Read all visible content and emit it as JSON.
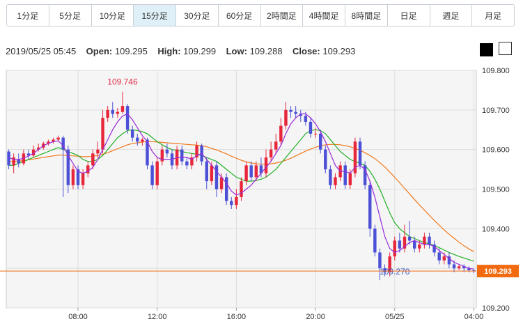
{
  "tabs": [
    {
      "label": "1分足"
    },
    {
      "label": "5分足"
    },
    {
      "label": "10分足"
    },
    {
      "label": "15分足",
      "active": true
    },
    {
      "label": "30分足"
    },
    {
      "label": "60分足"
    },
    {
      "label": "2時間足"
    },
    {
      "label": "4時間足"
    },
    {
      "label": "8時間足"
    },
    {
      "label": "日足"
    },
    {
      "label": "週足"
    },
    {
      "label": "月足"
    }
  ],
  "ohlc": {
    "datetime": "2019/05/25 05:45",
    "open_label": "Open:",
    "open": "109.295",
    "high_label": "High:",
    "high": "109.299",
    "low_label": "Low:",
    "low": "109.288",
    "close_label": "Close:",
    "close": "109.293"
  },
  "colors": {
    "up": "#e8263b",
    "down": "#4b50d6",
    "ma_short": "#9a2bd8",
    "ma_mid": "#21b024",
    "ma_long": "#f07a1e",
    "last_price_bg": "#f26a10",
    "plot_bg": "#f5f5f5",
    "grid": "#dddddd"
  },
  "chart_data": {
    "type": "candlestick",
    "ylim": [
      109.2,
      109.8
    ],
    "y_ticks": [
      "109.800",
      "109.700",
      "109.600",
      "109.500",
      "109.400",
      "109.300",
      "109.200"
    ],
    "x_ticks": [
      {
        "label": "08:00",
        "index": 14
      },
      {
        "label": "12:00",
        "index": 30
      },
      {
        "label": "16:00",
        "index": 46
      },
      {
        "label": "20:00",
        "index": 62
      },
      {
        "label": "05/25",
        "index": 78
      },
      {
        "label": "04:00",
        "index": 94
      }
    ],
    "high_annotation": {
      "label": "109.746",
      "index": 23
    },
    "low_annotation": {
      "label": "109.270",
      "index": 78
    },
    "last_price": {
      "label": "109.293",
      "value": 109.293
    },
    "candles": [
      [
        109.595,
        109.56,
        109.6,
        109.55
      ],
      [
        109.56,
        109.58,
        109.59,
        109.54
      ],
      [
        109.575,
        109.565,
        109.59,
        109.555
      ],
      [
        109.565,
        109.59,
        109.6,
        109.56
      ],
      [
        109.59,
        109.585,
        109.6,
        109.575
      ],
      [
        109.585,
        109.6,
        109.61,
        109.58
      ],
      [
        109.6,
        109.605,
        109.615,
        109.595
      ],
      [
        109.605,
        109.615,
        109.62,
        109.6
      ],
      [
        109.615,
        109.62,
        109.625,
        109.61
      ],
      [
        109.62,
        109.625,
        109.63,
        109.615
      ],
      [
        109.625,
        109.63,
        109.635,
        109.62
      ],
      [
        109.63,
        109.6,
        109.635,
        109.48
      ],
      [
        109.6,
        109.51,
        109.61,
        109.49
      ],
      [
        109.51,
        109.55,
        109.56,
        109.5
      ],
      [
        109.55,
        109.51,
        109.56,
        109.5
      ],
      [
        109.51,
        109.54,
        109.55,
        109.5
      ],
      [
        109.54,
        109.56,
        109.57,
        109.53
      ],
      [
        109.56,
        109.59,
        109.6,
        109.55
      ],
      [
        109.59,
        109.6,
        109.62,
        109.58
      ],
      [
        109.6,
        109.68,
        109.7,
        109.59
      ],
      [
        109.68,
        109.7,
        109.71,
        109.67
      ],
      [
        109.7,
        109.69,
        109.72,
        109.68
      ],
      [
        109.69,
        109.695,
        109.705,
        109.68
      ],
      [
        109.695,
        109.71,
        109.746,
        109.69
      ],
      [
        109.71,
        109.65,
        109.715,
        109.64
      ],
      [
        109.65,
        109.63,
        109.66,
        109.62
      ],
      [
        109.63,
        109.62,
        109.64,
        109.61
      ],
      [
        109.62,
        109.625,
        109.63,
        109.61
      ],
      [
        109.625,
        109.56,
        109.63,
        109.55
      ],
      [
        109.56,
        109.51,
        109.57,
        109.5
      ],
      [
        109.51,
        109.57,
        109.58,
        109.5
      ],
      [
        109.57,
        109.6,
        109.61,
        109.56
      ],
      [
        109.6,
        109.59,
        109.615,
        109.58
      ],
      [
        109.59,
        109.56,
        109.6,
        109.55
      ],
      [
        109.56,
        109.6,
        109.61,
        109.55
      ],
      [
        109.6,
        109.57,
        109.61,
        109.56
      ],
      [
        109.57,
        109.56,
        109.58,
        109.55
      ],
      [
        109.56,
        109.58,
        109.59,
        109.55
      ],
      [
        109.58,
        109.61,
        109.62,
        109.57
      ],
      [
        109.61,
        109.57,
        109.615,
        109.56
      ],
      [
        109.57,
        109.52,
        109.58,
        109.5
      ],
      [
        109.52,
        109.56,
        109.57,
        109.51
      ],
      [
        109.56,
        109.5,
        109.57,
        109.48
      ],
      [
        109.5,
        109.53,
        109.54,
        109.49
      ],
      [
        109.53,
        109.47,
        109.54,
        109.46
      ],
      [
        109.47,
        109.46,
        109.48,
        109.45
      ],
      [
        109.46,
        109.48,
        109.5,
        109.45
      ],
      [
        109.48,
        109.52,
        109.53,
        109.47
      ],
      [
        109.52,
        109.56,
        109.57,
        109.51
      ],
      [
        109.56,
        109.53,
        109.57,
        109.52
      ],
      [
        109.53,
        109.56,
        109.57,
        109.52
      ],
      [
        109.56,
        109.54,
        109.58,
        109.53
      ],
      [
        109.54,
        109.58,
        109.6,
        109.53
      ],
      [
        109.58,
        109.6,
        109.62,
        109.57
      ],
      [
        109.6,
        109.62,
        109.64,
        109.59
      ],
      [
        109.62,
        109.66,
        109.68,
        109.61
      ],
      [
        109.66,
        109.7,
        109.72,
        109.65
      ],
      [
        109.7,
        109.695,
        109.71,
        109.68
      ],
      [
        109.695,
        109.69,
        109.71,
        109.68
      ],
      [
        109.69,
        109.685,
        109.7,
        109.67
      ],
      [
        109.685,
        109.67,
        109.695,
        109.66
      ],
      [
        109.67,
        109.64,
        109.68,
        109.63
      ],
      [
        109.64,
        109.64,
        109.655,
        109.63
      ],
      [
        109.64,
        109.6,
        109.65,
        109.59
      ],
      [
        109.6,
        109.55,
        109.61,
        109.54
      ],
      [
        109.55,
        109.51,
        109.56,
        109.5
      ],
      [
        109.51,
        109.53,
        109.54,
        109.5
      ],
      [
        109.53,
        109.56,
        109.57,
        109.52
      ],
      [
        109.56,
        109.51,
        109.57,
        109.5
      ],
      [
        109.51,
        109.54,
        109.55,
        109.5
      ],
      [
        109.54,
        109.62,
        109.63,
        109.53
      ],
      [
        109.62,
        109.56,
        109.63,
        109.55
      ],
      [
        109.56,
        109.51,
        109.57,
        109.5
      ],
      [
        109.51,
        109.4,
        109.52,
        109.38
      ],
      [
        109.4,
        109.34,
        109.41,
        109.33
      ],
      [
        109.34,
        109.3,
        109.35,
        109.27
      ],
      [
        109.3,
        109.29,
        109.31,
        109.28
      ],
      [
        109.29,
        109.33,
        109.34,
        109.28
      ],
      [
        109.33,
        109.37,
        109.38,
        109.32
      ],
      [
        109.37,
        109.35,
        109.39,
        109.34
      ],
      [
        109.35,
        109.38,
        109.41,
        109.34
      ],
      [
        109.38,
        109.37,
        109.42,
        109.36
      ],
      [
        109.37,
        109.35,
        109.38,
        109.34
      ],
      [
        109.35,
        109.36,
        109.37,
        109.34
      ],
      [
        109.36,
        109.38,
        109.39,
        109.35
      ],
      [
        109.38,
        109.36,
        109.39,
        109.35
      ],
      [
        109.36,
        109.34,
        109.37,
        109.33
      ],
      [
        109.34,
        109.32,
        109.35,
        109.31
      ],
      [
        109.32,
        109.33,
        109.34,
        109.31
      ],
      [
        109.33,
        109.31,
        109.34,
        109.3
      ],
      [
        109.31,
        109.3,
        109.32,
        109.29
      ],
      [
        109.3,
        109.305,
        109.31,
        109.295
      ],
      [
        109.305,
        109.3,
        109.31,
        109.29
      ],
      [
        109.3,
        109.295,
        109.305,
        109.29
      ],
      [
        109.295,
        109.293,
        109.299,
        109.288
      ]
    ],
    "ma_short": [
      109.58,
      109.575,
      109.575,
      109.578,
      109.584,
      109.59,
      109.6,
      109.61,
      109.615,
      109.62,
      109.622,
      109.61,
      109.585,
      109.565,
      109.545,
      109.54,
      109.545,
      109.555,
      109.575,
      109.6,
      109.625,
      109.65,
      109.67,
      109.685,
      109.69,
      109.675,
      109.655,
      109.635,
      109.62,
      109.595,
      109.58,
      109.575,
      109.575,
      109.575,
      109.58,
      109.58,
      109.58,
      109.575,
      109.585,
      109.59,
      109.575,
      109.56,
      109.545,
      109.53,
      109.515,
      109.495,
      109.485,
      109.49,
      109.5,
      109.51,
      109.525,
      109.54,
      109.555,
      109.57,
      109.59,
      109.61,
      109.64,
      109.665,
      109.68,
      109.69,
      109.69,
      109.68,
      109.665,
      109.645,
      109.62,
      109.59,
      109.56,
      109.545,
      109.545,
      109.54,
      109.555,
      109.56,
      109.55,
      109.52,
      109.48,
      109.43,
      109.38,
      109.35,
      109.34,
      109.345,
      109.355,
      109.365,
      109.37,
      109.365,
      109.36,
      109.36,
      109.355,
      109.345,
      109.335,
      109.325,
      109.315,
      109.31,
      109.305,
      109.3,
      109.298
    ],
    "ma_mid": [
      109.56,
      109.56,
      109.565,
      109.57,
      109.575,
      109.58,
      109.585,
      109.59,
      109.595,
      109.6,
      109.605,
      109.6,
      109.595,
      109.59,
      109.585,
      109.575,
      109.57,
      109.57,
      109.575,
      109.585,
      109.6,
      109.615,
      109.63,
      109.64,
      109.648,
      109.65,
      109.648,
      109.645,
      109.64,
      109.63,
      109.62,
      109.612,
      109.605,
      109.6,
      109.598,
      109.595,
      109.592,
      109.59,
      109.588,
      109.585,
      109.58,
      109.575,
      109.57,
      109.56,
      109.55,
      109.54,
      109.53,
      109.525,
      109.52,
      109.52,
      109.522,
      109.525,
      109.53,
      109.54,
      109.55,
      109.565,
      109.58,
      109.595,
      109.61,
      109.625,
      109.64,
      109.648,
      109.65,
      109.648,
      109.64,
      109.625,
      109.61,
      109.595,
      109.585,
      109.575,
      109.57,
      109.565,
      109.56,
      109.545,
      109.525,
      109.5,
      109.47,
      109.44,
      109.415,
      109.4,
      109.39,
      109.38,
      109.375,
      109.37,
      109.365,
      109.362,
      109.358,
      109.352,
      109.346,
      109.34,
      109.335,
      109.33,
      109.326,
      109.322,
      109.318
    ],
    "ma_long": [
      109.57,
      109.57,
      109.571,
      109.572,
      109.574,
      109.576,
      109.578,
      109.58,
      109.582,
      109.584,
      109.586,
      109.586,
      109.585,
      109.584,
      109.583,
      109.582,
      109.582,
      109.583,
      109.585,
      109.588,
      109.592,
      109.597,
      109.602,
      109.607,
      109.612,
      109.615,
      109.617,
      109.619,
      109.62,
      109.62,
      109.619,
      109.618,
      109.617,
      109.616,
      109.615,
      109.614,
      109.613,
      109.612,
      109.611,
      109.61,
      109.607,
      109.603,
      109.599,
      109.594,
      109.589,
      109.583,
      109.578,
      109.573,
      109.569,
      109.566,
      109.564,
      109.563,
      109.563,
      109.564,
      109.566,
      109.569,
      109.573,
      109.578,
      109.584,
      109.59,
      109.596,
      109.601,
      109.606,
      109.609,
      109.612,
      109.613,
      109.613,
      109.612,
      109.61,
      109.607,
      109.603,
      109.598,
      109.592,
      109.585,
      109.577,
      109.567,
      109.556,
      109.543,
      109.53,
      109.516,
      109.502,
      109.488,
      109.474,
      109.46,
      109.447,
      109.434,
      109.421,
      109.409,
      109.397,
      109.386,
      109.376,
      109.366,
      109.357,
      109.349,
      109.342
    ]
  }
}
